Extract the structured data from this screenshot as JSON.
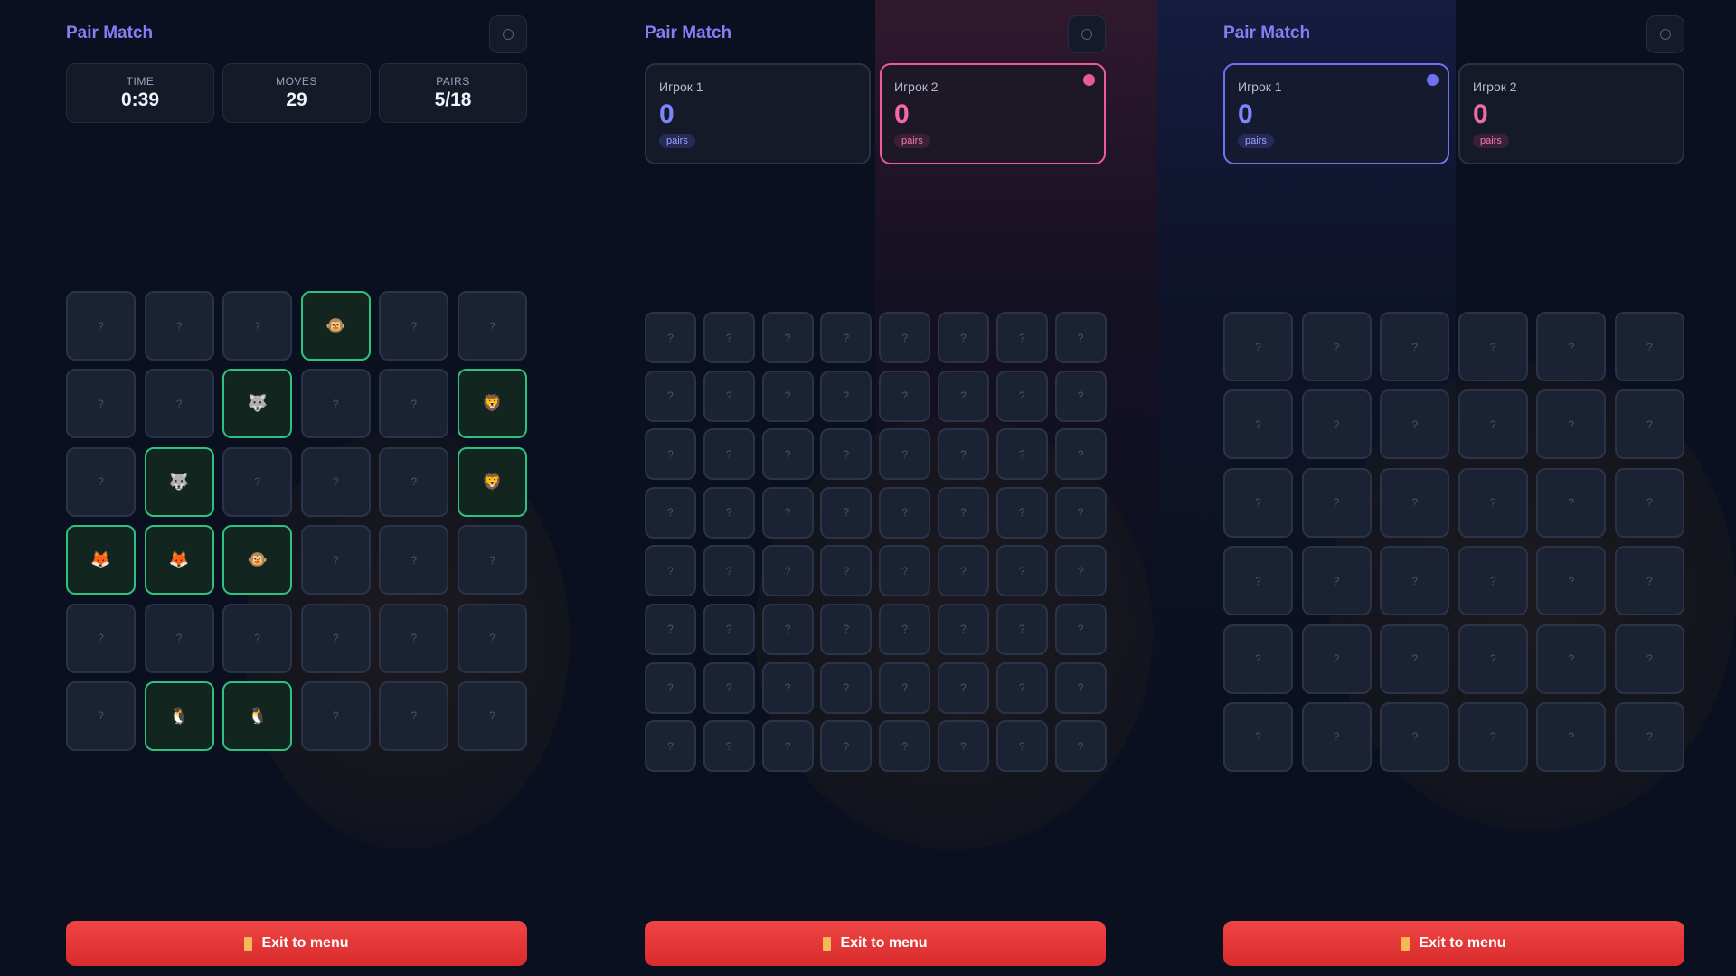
{
  "app": {
    "title": "Pair Match"
  },
  "panels": [
    {
      "mode": "solo",
      "stats": [
        {
          "label": "TIME",
          "value": "0:39"
        },
        {
          "label": "MOVES",
          "value": "29"
        },
        {
          "label": "PAIRS",
          "value": "5/18"
        }
      ],
      "grid": {
        "cols": 6,
        "rows": 6,
        "cards": [
          "?",
          "?",
          "?",
          "🐵",
          "?",
          "?",
          "?",
          "?",
          "🐺",
          "?",
          "?",
          "🦁",
          "?",
          "🐺",
          "?",
          "?",
          "?",
          "🦁",
          "🦊",
          "🦊",
          "🐵",
          "?",
          "?",
          "?",
          "?",
          "?",
          "?",
          "?",
          "?",
          "?",
          "?",
          "🐧",
          "🐧",
          "?",
          "?",
          "?"
        ]
      },
      "exit_label": "Exit to menu"
    },
    {
      "mode": "versus",
      "players": [
        {
          "name": "Игрок 1",
          "score": "0",
          "tag": "pairs",
          "active": false
        },
        {
          "name": "Игрок 2",
          "score": "0",
          "tag": "pairs",
          "active": true
        }
      ],
      "grid": {
        "cols": 8,
        "rows": 8,
        "hidden_label": "?"
      },
      "exit_label": "Exit to menu"
    },
    {
      "mode": "versus",
      "players": [
        {
          "name": "Игрок 1",
          "score": "0",
          "tag": "pairs",
          "active": true
        },
        {
          "name": "Игрок 2",
          "score": "0",
          "tag": "pairs",
          "active": false
        }
      ],
      "grid": {
        "cols": 6,
        "rows": 6,
        "hidden_label": "?"
      },
      "exit_label": "Exit to menu"
    }
  ],
  "icons": {
    "settings": "gear-icon",
    "exit": "door-icon",
    "turn_indicator": "turn-dot-icon",
    "card_faces": [
      "monkey-icon",
      "wolf-icon",
      "lion-icon",
      "fox-icon",
      "penguin-icon"
    ]
  },
  "colors": {
    "brand": "#8b7cf6",
    "player1": "#7d86ff",
    "player2": "#f06aa8",
    "matched": "#2ec27e",
    "exit": "#ef4545"
  }
}
